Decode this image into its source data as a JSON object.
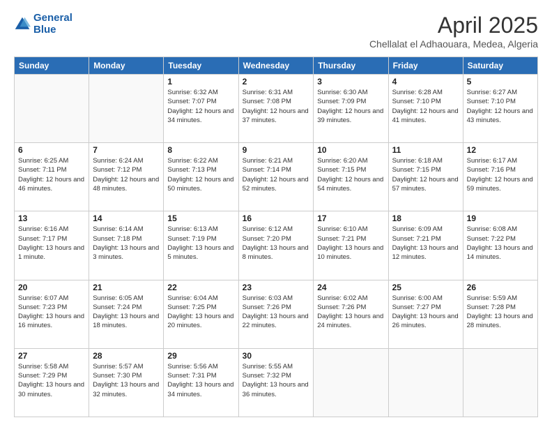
{
  "header": {
    "logo_line1": "General",
    "logo_line2": "Blue",
    "title": "April 2025",
    "subtitle": "Chellalat el Adhaouara, Medea, Algeria"
  },
  "calendar": {
    "weekdays": [
      "Sunday",
      "Monday",
      "Tuesday",
      "Wednesday",
      "Thursday",
      "Friday",
      "Saturday"
    ],
    "rows": [
      [
        {
          "day": "",
          "sunrise": "",
          "sunset": "",
          "daylight": ""
        },
        {
          "day": "",
          "sunrise": "",
          "sunset": "",
          "daylight": ""
        },
        {
          "day": "1",
          "sunrise": "Sunrise: 6:32 AM",
          "sunset": "Sunset: 7:07 PM",
          "daylight": "Daylight: 12 hours and 34 minutes."
        },
        {
          "day": "2",
          "sunrise": "Sunrise: 6:31 AM",
          "sunset": "Sunset: 7:08 PM",
          "daylight": "Daylight: 12 hours and 37 minutes."
        },
        {
          "day": "3",
          "sunrise": "Sunrise: 6:30 AM",
          "sunset": "Sunset: 7:09 PM",
          "daylight": "Daylight: 12 hours and 39 minutes."
        },
        {
          "day": "4",
          "sunrise": "Sunrise: 6:28 AM",
          "sunset": "Sunset: 7:10 PM",
          "daylight": "Daylight: 12 hours and 41 minutes."
        },
        {
          "day": "5",
          "sunrise": "Sunrise: 6:27 AM",
          "sunset": "Sunset: 7:10 PM",
          "daylight": "Daylight: 12 hours and 43 minutes."
        }
      ],
      [
        {
          "day": "6",
          "sunrise": "Sunrise: 6:25 AM",
          "sunset": "Sunset: 7:11 PM",
          "daylight": "Daylight: 12 hours and 46 minutes."
        },
        {
          "day": "7",
          "sunrise": "Sunrise: 6:24 AM",
          "sunset": "Sunset: 7:12 PM",
          "daylight": "Daylight: 12 hours and 48 minutes."
        },
        {
          "day": "8",
          "sunrise": "Sunrise: 6:22 AM",
          "sunset": "Sunset: 7:13 PM",
          "daylight": "Daylight: 12 hours and 50 minutes."
        },
        {
          "day": "9",
          "sunrise": "Sunrise: 6:21 AM",
          "sunset": "Sunset: 7:14 PM",
          "daylight": "Daylight: 12 hours and 52 minutes."
        },
        {
          "day": "10",
          "sunrise": "Sunrise: 6:20 AM",
          "sunset": "Sunset: 7:15 PM",
          "daylight": "Daylight: 12 hours and 54 minutes."
        },
        {
          "day": "11",
          "sunrise": "Sunrise: 6:18 AM",
          "sunset": "Sunset: 7:15 PM",
          "daylight": "Daylight: 12 hours and 57 minutes."
        },
        {
          "day": "12",
          "sunrise": "Sunrise: 6:17 AM",
          "sunset": "Sunset: 7:16 PM",
          "daylight": "Daylight: 12 hours and 59 minutes."
        }
      ],
      [
        {
          "day": "13",
          "sunrise": "Sunrise: 6:16 AM",
          "sunset": "Sunset: 7:17 PM",
          "daylight": "Daylight: 13 hours and 1 minute."
        },
        {
          "day": "14",
          "sunrise": "Sunrise: 6:14 AM",
          "sunset": "Sunset: 7:18 PM",
          "daylight": "Daylight: 13 hours and 3 minutes."
        },
        {
          "day": "15",
          "sunrise": "Sunrise: 6:13 AM",
          "sunset": "Sunset: 7:19 PM",
          "daylight": "Daylight: 13 hours and 5 minutes."
        },
        {
          "day": "16",
          "sunrise": "Sunrise: 6:12 AM",
          "sunset": "Sunset: 7:20 PM",
          "daylight": "Daylight: 13 hours and 8 minutes."
        },
        {
          "day": "17",
          "sunrise": "Sunrise: 6:10 AM",
          "sunset": "Sunset: 7:21 PM",
          "daylight": "Daylight: 13 hours and 10 minutes."
        },
        {
          "day": "18",
          "sunrise": "Sunrise: 6:09 AM",
          "sunset": "Sunset: 7:21 PM",
          "daylight": "Daylight: 13 hours and 12 minutes."
        },
        {
          "day": "19",
          "sunrise": "Sunrise: 6:08 AM",
          "sunset": "Sunset: 7:22 PM",
          "daylight": "Daylight: 13 hours and 14 minutes."
        }
      ],
      [
        {
          "day": "20",
          "sunrise": "Sunrise: 6:07 AM",
          "sunset": "Sunset: 7:23 PM",
          "daylight": "Daylight: 13 hours and 16 minutes."
        },
        {
          "day": "21",
          "sunrise": "Sunrise: 6:05 AM",
          "sunset": "Sunset: 7:24 PM",
          "daylight": "Daylight: 13 hours and 18 minutes."
        },
        {
          "day": "22",
          "sunrise": "Sunrise: 6:04 AM",
          "sunset": "Sunset: 7:25 PM",
          "daylight": "Daylight: 13 hours and 20 minutes."
        },
        {
          "day": "23",
          "sunrise": "Sunrise: 6:03 AM",
          "sunset": "Sunset: 7:26 PM",
          "daylight": "Daylight: 13 hours and 22 minutes."
        },
        {
          "day": "24",
          "sunrise": "Sunrise: 6:02 AM",
          "sunset": "Sunset: 7:26 PM",
          "daylight": "Daylight: 13 hours and 24 minutes."
        },
        {
          "day": "25",
          "sunrise": "Sunrise: 6:00 AM",
          "sunset": "Sunset: 7:27 PM",
          "daylight": "Daylight: 13 hours and 26 minutes."
        },
        {
          "day": "26",
          "sunrise": "Sunrise: 5:59 AM",
          "sunset": "Sunset: 7:28 PM",
          "daylight": "Daylight: 13 hours and 28 minutes."
        }
      ],
      [
        {
          "day": "27",
          "sunrise": "Sunrise: 5:58 AM",
          "sunset": "Sunset: 7:29 PM",
          "daylight": "Daylight: 13 hours and 30 minutes."
        },
        {
          "day": "28",
          "sunrise": "Sunrise: 5:57 AM",
          "sunset": "Sunset: 7:30 PM",
          "daylight": "Daylight: 13 hours and 32 minutes."
        },
        {
          "day": "29",
          "sunrise": "Sunrise: 5:56 AM",
          "sunset": "Sunset: 7:31 PM",
          "daylight": "Daylight: 13 hours and 34 minutes."
        },
        {
          "day": "30",
          "sunrise": "Sunrise: 5:55 AM",
          "sunset": "Sunset: 7:32 PM",
          "daylight": "Daylight: 13 hours and 36 minutes."
        },
        {
          "day": "",
          "sunrise": "",
          "sunset": "",
          "daylight": ""
        },
        {
          "day": "",
          "sunrise": "",
          "sunset": "",
          "daylight": ""
        },
        {
          "day": "",
          "sunrise": "",
          "sunset": "",
          "daylight": ""
        }
      ]
    ]
  }
}
